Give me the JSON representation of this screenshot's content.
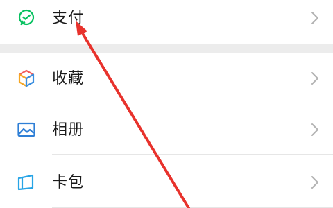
{
  "menu": {
    "items": [
      {
        "label": "支付",
        "icon": "wechat-pay-icon"
      },
      {
        "label": "收藏",
        "icon": "favorites-cube-icon"
      },
      {
        "label": "相册",
        "icon": "album-image-icon"
      },
      {
        "label": "卡包",
        "icon": "card-wallet-icon"
      }
    ]
  },
  "colors": {
    "pay_green": "#07c160",
    "annotation_red": "#e8322c",
    "chevron": "#b2b2b2",
    "album_blue": "#2f7fd6",
    "cards_blue": "#27a4e6"
  }
}
